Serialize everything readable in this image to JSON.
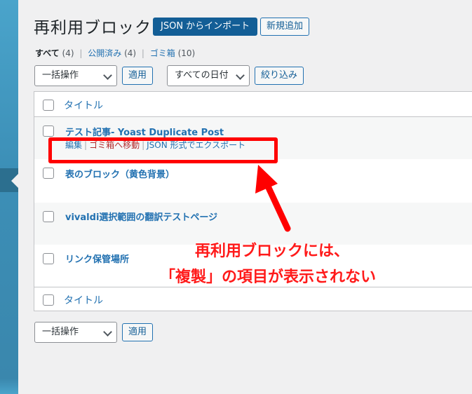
{
  "page": {
    "title": "再利用ブロック",
    "import_button": "JSON からインポート",
    "add_new_button": "新規追加"
  },
  "views": {
    "all": {
      "label": "すべて",
      "count": "(4)"
    },
    "published": {
      "label": "公開済み",
      "count": "(4)"
    },
    "trash": {
      "label": "ゴミ箱",
      "count": "(10)"
    },
    "separator": "|"
  },
  "top_actions": {
    "bulk_select": "一括操作",
    "apply": "適用",
    "date_select": "すべての日付",
    "filter": "絞り込み"
  },
  "table": {
    "column_title": "タイトル",
    "rows": [
      {
        "title": "テスト記事- Yoast Duplicate Post"
      },
      {
        "title": "表のブロック（黄色背景）"
      },
      {
        "title": "vivaldi選択範囲の翻訳テストページ"
      },
      {
        "title": "リンク保管場所"
      }
    ],
    "row_actions": {
      "edit": "編集",
      "trash": "ゴミ箱へ移動",
      "export": "JSON 形式でエクスポート",
      "separator": "|"
    }
  },
  "bottom_actions": {
    "bulk_select": "一括操作",
    "apply": "適用"
  },
  "annotation": {
    "line1": "再利用ブロックには、",
    "line2": "「複製」の項目が表示されない",
    "color": "#ff0000"
  },
  "colors": {
    "accent": "#2271b1",
    "primary_button": "#135e96",
    "sidebar": "#3c8fb7",
    "trash_link": "#b32d2e"
  }
}
